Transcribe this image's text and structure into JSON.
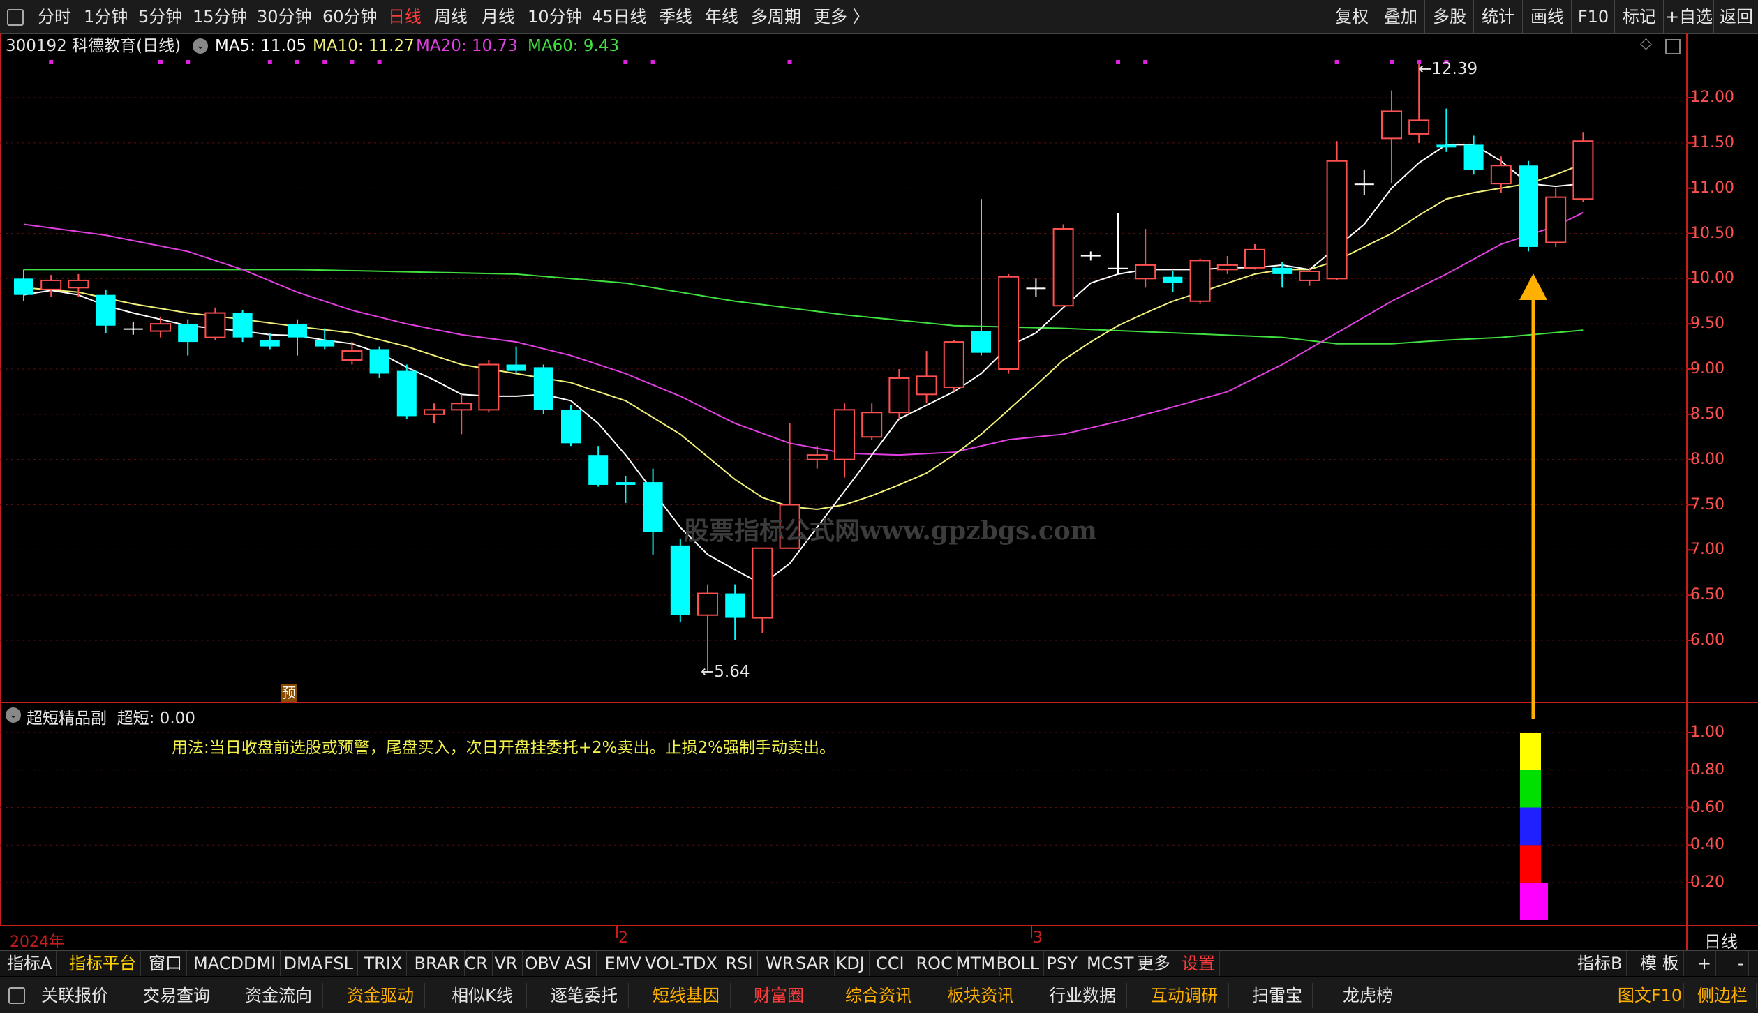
{
  "topbar": {
    "left_items": [
      {
        "label": "分时",
        "x": 54
      },
      {
        "label": "1分钟",
        "x": 120
      },
      {
        "label": "5分钟",
        "x": 198
      },
      {
        "label": "15分钟",
        "x": 276
      },
      {
        "label": "30分钟",
        "x": 368
      },
      {
        "label": "60分钟",
        "x": 462
      },
      {
        "label": "日线",
        "x": 556,
        "active": true
      },
      {
        "label": "周线",
        "x": 622
      },
      {
        "label": "月线",
        "x": 690
      },
      {
        "label": "10分钟",
        "x": 756
      },
      {
        "label": "45日线",
        "x": 848
      },
      {
        "label": "季线",
        "x": 944
      },
      {
        "label": "年线",
        "x": 1010
      },
      {
        "label": "多周期",
        "x": 1076
      },
      {
        "label": "更多 〉",
        "x": 1166
      }
    ],
    "right_items": [
      "复权",
      "叠加",
      "多股",
      "统计",
      "画线",
      "F10",
      "标记",
      "+自选",
      "返回"
    ]
  },
  "header": {
    "code_name": "300192 科德教育(日线)",
    "ma5": "MA5: 11.05",
    "ma10": "MA10: 11.27",
    "ma20": "MA20: 10.73",
    "ma60": "MA60: 9.43"
  },
  "colors": {
    "up": "#ff5050",
    "down": "#00ffff",
    "ma5": "#ffffff",
    "ma10": "#f0f07a",
    "ma20": "#e040e0",
    "ma60": "#40e040",
    "axis": "#c81e1e"
  },
  "main_chart": {
    "yaxis_ticks": [
      "12.00",
      "11.50",
      "11.00",
      "10.50",
      "10.00",
      "9.50",
      "9.00",
      "8.50",
      "8.00",
      "7.50",
      "7.00",
      "6.50",
      "6.00"
    ],
    "high_label": "12.39",
    "low_label": "5.64",
    "watermark": "股票指标公式网www.gpzbgs.com",
    "pre_marker": "预"
  },
  "chart_data": {
    "type": "candlestick",
    "ylim": [
      5.35,
      12.55
    ],
    "candles": [
      [
        10.0,
        9.82,
        10.1,
        9.75
      ],
      [
        9.88,
        9.98,
        10.04,
        9.8
      ],
      [
        9.9,
        9.98,
        10.05,
        9.8
      ],
      [
        9.82,
        9.48,
        9.88,
        9.4
      ],
      [
        9.45,
        9.45,
        9.52,
        9.38
      ],
      [
        9.42,
        9.5,
        9.58,
        9.35
      ],
      [
        9.5,
        9.3,
        9.55,
        9.15
      ],
      [
        9.35,
        9.62,
        9.68,
        9.32
      ],
      [
        9.62,
        9.35,
        9.65,
        9.3
      ],
      [
        9.32,
        9.25,
        9.4,
        9.22
      ],
      [
        9.5,
        9.35,
        9.55,
        9.15
      ],
      [
        9.32,
        9.25,
        9.45,
        9.22
      ],
      [
        9.1,
        9.2,
        9.3,
        9.05
      ],
      [
        9.22,
        8.95,
        9.25,
        8.9
      ],
      [
        8.98,
        8.48,
        9.05,
        8.45
      ],
      [
        8.5,
        8.55,
        8.62,
        8.4
      ],
      [
        8.55,
        8.62,
        8.72,
        8.28
      ],
      [
        8.55,
        9.05,
        9.1,
        8.52
      ],
      [
        9.05,
        8.98,
        9.25,
        8.95
      ],
      [
        9.02,
        8.55,
        9.05,
        8.5
      ],
      [
        8.55,
        8.18,
        8.6,
        8.15
      ],
      [
        8.05,
        7.72,
        8.15,
        7.7
      ],
      [
        7.75,
        7.72,
        7.82,
        7.52
      ],
      [
        7.75,
        7.2,
        7.9,
        6.95
      ],
      [
        7.05,
        6.28,
        7.12,
        6.2
      ],
      [
        6.28,
        6.52,
        6.62,
        5.64
      ],
      [
        6.52,
        6.25,
        6.62,
        6.0
      ],
      [
        6.25,
        7.02,
        7.02,
        6.08
      ],
      [
        7.02,
        7.5,
        8.4,
        7.45
      ],
      [
        8.0,
        8.05,
        8.15,
        7.9
      ],
      [
        8.0,
        8.55,
        8.62,
        7.8
      ],
      [
        8.25,
        8.52,
        8.62,
        8.22
      ],
      [
        8.52,
        8.9,
        9.0,
        8.45
      ],
      [
        8.72,
        8.92,
        9.2,
        8.62
      ],
      [
        8.8,
        9.3,
        9.32,
        8.75
      ],
      [
        9.42,
        9.18,
        10.88,
        9.15
      ],
      [
        9.0,
        10.02,
        10.05,
        8.95
      ],
      [
        9.9,
        9.9,
        10.0,
        9.8
      ],
      [
        9.7,
        10.55,
        10.6,
        9.7
      ],
      [
        10.26,
        10.26,
        10.3,
        10.2
      ],
      [
        10.12,
        10.12,
        10.72,
        10.05
      ],
      [
        10.0,
        10.15,
        10.55,
        9.9
      ],
      [
        10.02,
        9.95,
        10.08,
        9.85
      ],
      [
        9.75,
        10.2,
        10.22,
        9.72
      ],
      [
        10.1,
        10.15,
        10.25,
        10.05
      ],
      [
        10.12,
        10.32,
        10.38,
        10.1
      ],
      [
        10.12,
        10.05,
        10.18,
        9.9
      ],
      [
        9.98,
        10.08,
        10.12,
        9.92
      ],
      [
        10.0,
        11.3,
        11.52,
        9.98
      ],
      [
        11.05,
        11.05,
        11.2,
        10.92
      ],
      [
        11.55,
        11.85,
        12.08,
        11.05
      ],
      [
        11.6,
        11.75,
        12.39,
        11.5
      ],
      [
        11.48,
        11.45,
        11.88,
        11.4
      ],
      [
        11.48,
        11.2,
        11.58,
        11.15
      ],
      [
        11.05,
        11.25,
        11.35,
        10.95
      ],
      [
        11.25,
        10.35,
        11.3,
        10.3
      ],
      [
        10.4,
        10.9,
        11.0,
        10.35
      ],
      [
        10.88,
        11.52,
        11.62,
        10.85
      ]
    ],
    "ma5": [
      [
        0,
        9.82
      ],
      [
        1,
        9.87
      ],
      [
        2,
        9.82
      ],
      [
        3,
        9.7
      ],
      [
        4,
        9.62
      ],
      [
        5,
        9.55
      ],
      [
        6,
        9.48
      ],
      [
        7,
        9.45
      ],
      [
        8,
        9.42
      ],
      [
        9,
        9.38
      ],
      [
        10,
        9.37
      ],
      [
        11,
        9.32
      ],
      [
        12,
        9.28
      ],
      [
        13,
        9.18
      ],
      [
        14,
        9.02
      ],
      [
        15,
        8.88
      ],
      [
        16,
        8.72
      ],
      [
        17,
        8.7
      ],
      [
        18,
        8.7
      ],
      [
        19,
        8.72
      ],
      [
        20,
        8.65
      ],
      [
        21,
        8.4
      ],
      [
        22,
        8.05
      ],
      [
        23,
        7.65
      ],
      [
        24,
        7.25
      ],
      [
        25,
        6.95
      ],
      [
        26,
        6.78
      ],
      [
        27,
        6.62
      ],
      [
        28,
        6.85
      ],
      [
        29,
        7.25
      ],
      [
        30,
        7.65
      ],
      [
        31,
        8.05
      ],
      [
        32,
        8.45
      ],
      [
        33,
        8.6
      ],
      [
        34,
        8.75
      ],
      [
        35,
        8.95
      ],
      [
        36,
        9.25
      ],
      [
        37,
        9.4
      ],
      [
        38,
        9.68
      ],
      [
        39,
        9.95
      ],
      [
        40,
        10.05
      ],
      [
        41,
        10.1
      ],
      [
        42,
        10.1
      ],
      [
        43,
        10.1
      ],
      [
        44,
        10.12
      ],
      [
        45,
        10.12
      ],
      [
        46,
        10.15
      ],
      [
        47,
        10.1
      ],
      [
        48,
        10.35
      ],
      [
        49,
        10.6
      ],
      [
        50,
        11.0
      ],
      [
        51,
        11.28
      ],
      [
        52,
        11.48
      ],
      [
        53,
        11.48
      ],
      [
        54,
        11.3
      ],
      [
        55,
        11.05
      ],
      [
        56,
        11.02
      ],
      [
        57,
        11.05
      ]
    ],
    "ma10": [
      [
        0,
        9.9
      ],
      [
        2,
        9.85
      ],
      [
        4,
        9.72
      ],
      [
        6,
        9.62
      ],
      [
        8,
        9.55
      ],
      [
        10,
        9.47
      ],
      [
        12,
        9.4
      ],
      [
        14,
        9.25
      ],
      [
        16,
        9.05
      ],
      [
        18,
        8.95
      ],
      [
        20,
        8.85
      ],
      [
        22,
        8.65
      ],
      [
        24,
        8.28
      ],
      [
        26,
        7.78
      ],
      [
        27,
        7.58
      ],
      [
        28,
        7.48
      ],
      [
        29,
        7.45
      ],
      [
        30,
        7.5
      ],
      [
        31,
        7.6
      ],
      [
        32,
        7.72
      ],
      [
        33,
        7.85
      ],
      [
        34,
        8.05
      ],
      [
        35,
        8.28
      ],
      [
        36,
        8.55
      ],
      [
        37,
        8.82
      ],
      [
        38,
        9.1
      ],
      [
        39,
        9.3
      ],
      [
        40,
        9.48
      ],
      [
        41,
        9.62
      ],
      [
        42,
        9.75
      ],
      [
        43,
        9.85
      ],
      [
        44,
        9.95
      ],
      [
        45,
        10.05
      ],
      [
        46,
        10.1
      ],
      [
        47,
        10.1
      ],
      [
        48,
        10.2
      ],
      [
        49,
        10.35
      ],
      [
        50,
        10.5
      ],
      [
        51,
        10.7
      ],
      [
        52,
        10.88
      ],
      [
        53,
        10.95
      ],
      [
        54,
        11.0
      ],
      [
        55,
        11.05
      ],
      [
        56,
        11.15
      ],
      [
        57,
        11.27
      ]
    ],
    "ma20": [
      [
        0,
        10.6
      ],
      [
        3,
        10.48
      ],
      [
        6,
        10.3
      ],
      [
        8,
        10.1
      ],
      [
        10,
        9.85
      ],
      [
        12,
        9.65
      ],
      [
        14,
        9.5
      ],
      [
        16,
        9.38
      ],
      [
        18,
        9.3
      ],
      [
        20,
        9.15
      ],
      [
        22,
        8.95
      ],
      [
        24,
        8.7
      ],
      [
        26,
        8.4
      ],
      [
        28,
        8.18
      ],
      [
        30,
        8.07
      ],
      [
        32,
        8.05
      ],
      [
        34,
        8.08
      ],
      [
        36,
        8.22
      ],
      [
        38,
        8.28
      ],
      [
        40,
        8.42
      ],
      [
        42,
        8.58
      ],
      [
        44,
        8.75
      ],
      [
        46,
        9.05
      ],
      [
        48,
        9.4
      ],
      [
        50,
        9.75
      ],
      [
        52,
        10.05
      ],
      [
        54,
        10.38
      ],
      [
        56,
        10.58
      ],
      [
        57,
        10.73
      ]
    ],
    "ma60": [
      [
        0,
        10.1
      ],
      [
        10,
        10.1
      ],
      [
        18,
        10.05
      ],
      [
        22,
        9.95
      ],
      [
        26,
        9.75
      ],
      [
        30,
        9.6
      ],
      [
        34,
        9.48
      ],
      [
        38,
        9.45
      ],
      [
        42,
        9.4
      ],
      [
        46,
        9.35
      ],
      [
        48,
        9.28
      ],
      [
        50,
        9.28
      ],
      [
        52,
        9.32
      ],
      [
        54,
        9.35
      ],
      [
        57,
        9.43
      ]
    ],
    "purple_markers": [
      1,
      5,
      6,
      9,
      10,
      11,
      12,
      13,
      22,
      23,
      28,
      40,
      41,
      48,
      50,
      51,
      52
    ]
  },
  "sub_chart": {
    "title": "超短精品副",
    "value_label": "超短: 0.00",
    "note": "用法:当日收盘前选股或预警，尾盘买入，次日开盘挂委托+2%卖出。止损2%强制手动卖出。",
    "yaxis_ticks": [
      "1.00",
      "0.80",
      "0.60",
      "0.40",
      "0.20"
    ],
    "bar_index": 55,
    "bar_segments": [
      {
        "from": 0.0,
        "to": 0.2,
        "color": "#ff00ff"
      },
      {
        "from": 0.2,
        "to": 0.4,
        "color": "#ff0000"
      },
      {
        "from": 0.4,
        "to": 0.6,
        "color": "#2020ff"
      },
      {
        "from": 0.6,
        "to": 0.8,
        "color": "#00e000"
      },
      {
        "from": 0.8,
        "to": 1.0,
        "color": "#ffff00"
      }
    ]
  },
  "xaxis": {
    "year_label": "2024年",
    "month2": "2",
    "month3": "3",
    "period": "日线"
  },
  "indicator_bar": {
    "items": [
      "指标A",
      "指标平台",
      "窗口",
      "MACD",
      "DMI",
      "DMA",
      "FSL",
      "TRIX",
      "BRAR",
      "CR",
      "VR",
      "OBV",
      "ASI",
      "EMV",
      "VOL-TDX",
      "RSI",
      "WR",
      "SAR",
      "KDJ",
      "CCI",
      "ROC",
      "MTM",
      "BOLL",
      "PSY",
      "MCST",
      "更多",
      "设置"
    ],
    "right_items": [
      "指标B",
      "模 板",
      "+",
      "-"
    ]
  },
  "func_bar": {
    "items": [
      {
        "label": "关联报价",
        "color": "#e6e6e6"
      },
      {
        "label": "交易查询",
        "color": "#e6e6e6"
      },
      {
        "label": "资金流向",
        "color": "#e6e6e6"
      },
      {
        "label": "资金驱动",
        "color": "#ffb000"
      },
      {
        "label": "相似K线",
        "color": "#e6e6e6"
      },
      {
        "label": "逐笔委托",
        "color": "#e6e6e6"
      },
      {
        "label": "短线基因",
        "color": "#ffb000"
      },
      {
        "label": "财富圈",
        "color": "#ff3c3c"
      },
      {
        "label": "综合资讯",
        "color": "#ffb000"
      },
      {
        "label": "板块资讯",
        "color": "#ffb000"
      },
      {
        "label": "行业数据",
        "color": "#e6e6e6"
      },
      {
        "label": "互动调研",
        "color": "#ffb000"
      },
      {
        "label": "扫雷宝",
        "color": "#e6e6e6"
      },
      {
        "label": "龙虎榜",
        "color": "#e6e6e6"
      }
    ],
    "right_items": [
      "图文F10",
      "侧边栏"
    ]
  }
}
